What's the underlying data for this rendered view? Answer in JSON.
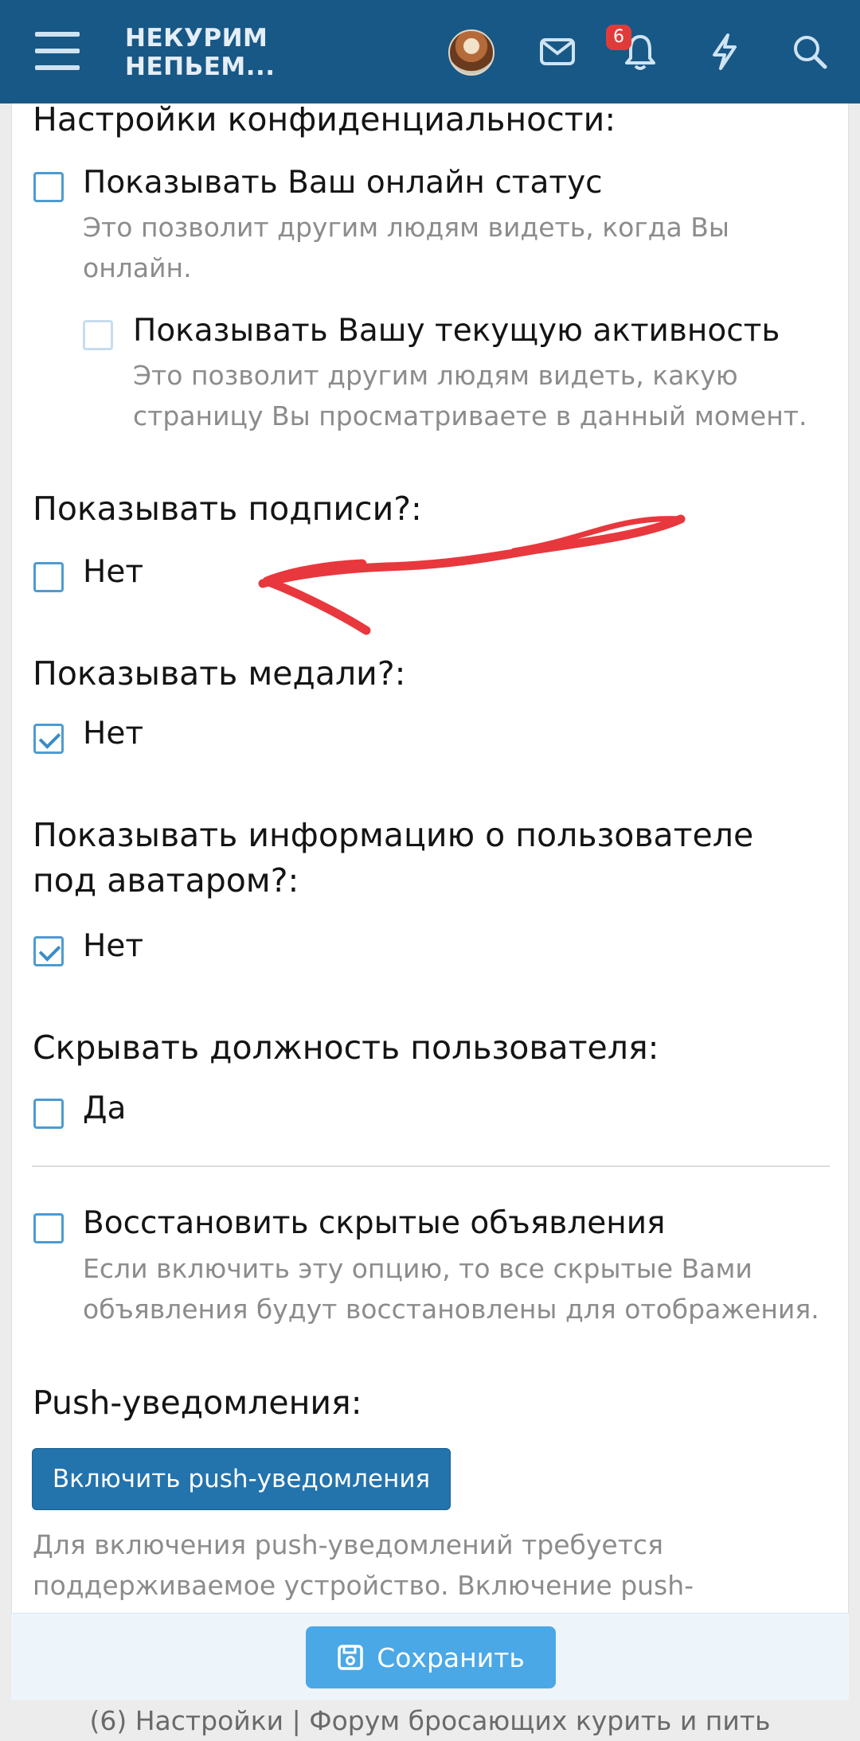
{
  "header": {
    "logo_line1": "НЕКУРИМ",
    "logo_line2": "НЕПЬЕМ...",
    "notification_count": "6",
    "icons": [
      "menu-icon",
      "avatar",
      "mail-icon",
      "bell-icon",
      "lightning-icon",
      "search-icon"
    ],
    "bar_color": "#185886"
  },
  "privacy": {
    "heading": "Настройки конфиденциальности:",
    "online_label": "Показывать Ваш онлайн статус",
    "online_hint_1": "Это позволит другим людям видеть, когда Вы",
    "online_hint_2": "онлайн.",
    "activity_label": "Показывать Вашу текущую активность",
    "activity_hint_1": "Это позволит другим людям видеть, какую",
    "activity_hint_2": "страницу Вы просматриваете в данный момент."
  },
  "signatures": {
    "heading": "Показывать подписи?:",
    "option": "Нет",
    "checked": false
  },
  "medals": {
    "heading": "Показывать медали?:",
    "option": "Нет",
    "checked": true
  },
  "user_info": {
    "heading_1": "Показывать информацию о пользователе",
    "heading_2": "под аватаром?:",
    "option": "Нет",
    "checked": true
  },
  "hide_title": {
    "heading": "Скрывать должность пользователя:",
    "option": "Да",
    "checked": false
  },
  "restore": {
    "label": "Восстановить скрытые объявления",
    "hint_1": "Если включить эту опцию, то все скрытые Вами",
    "hint_2": "объявления будут восстановлены для отображения."
  },
  "push": {
    "heading": "Push-уведомления:",
    "button": "Включить push-уведомления",
    "hint_1": "Для включения push-уведомлений требуется",
    "hint_2": "поддерживаемое устройство. Включение push-"
  },
  "footer": {
    "save_button": "Сохранить",
    "tab_title": "(6) Настройки | Форум бросающих курить и пить"
  },
  "colors": {
    "accent": "#4e9bd1",
    "button": "#2373ad",
    "save": "#4aa8e6",
    "annotation": "#e8383d"
  }
}
